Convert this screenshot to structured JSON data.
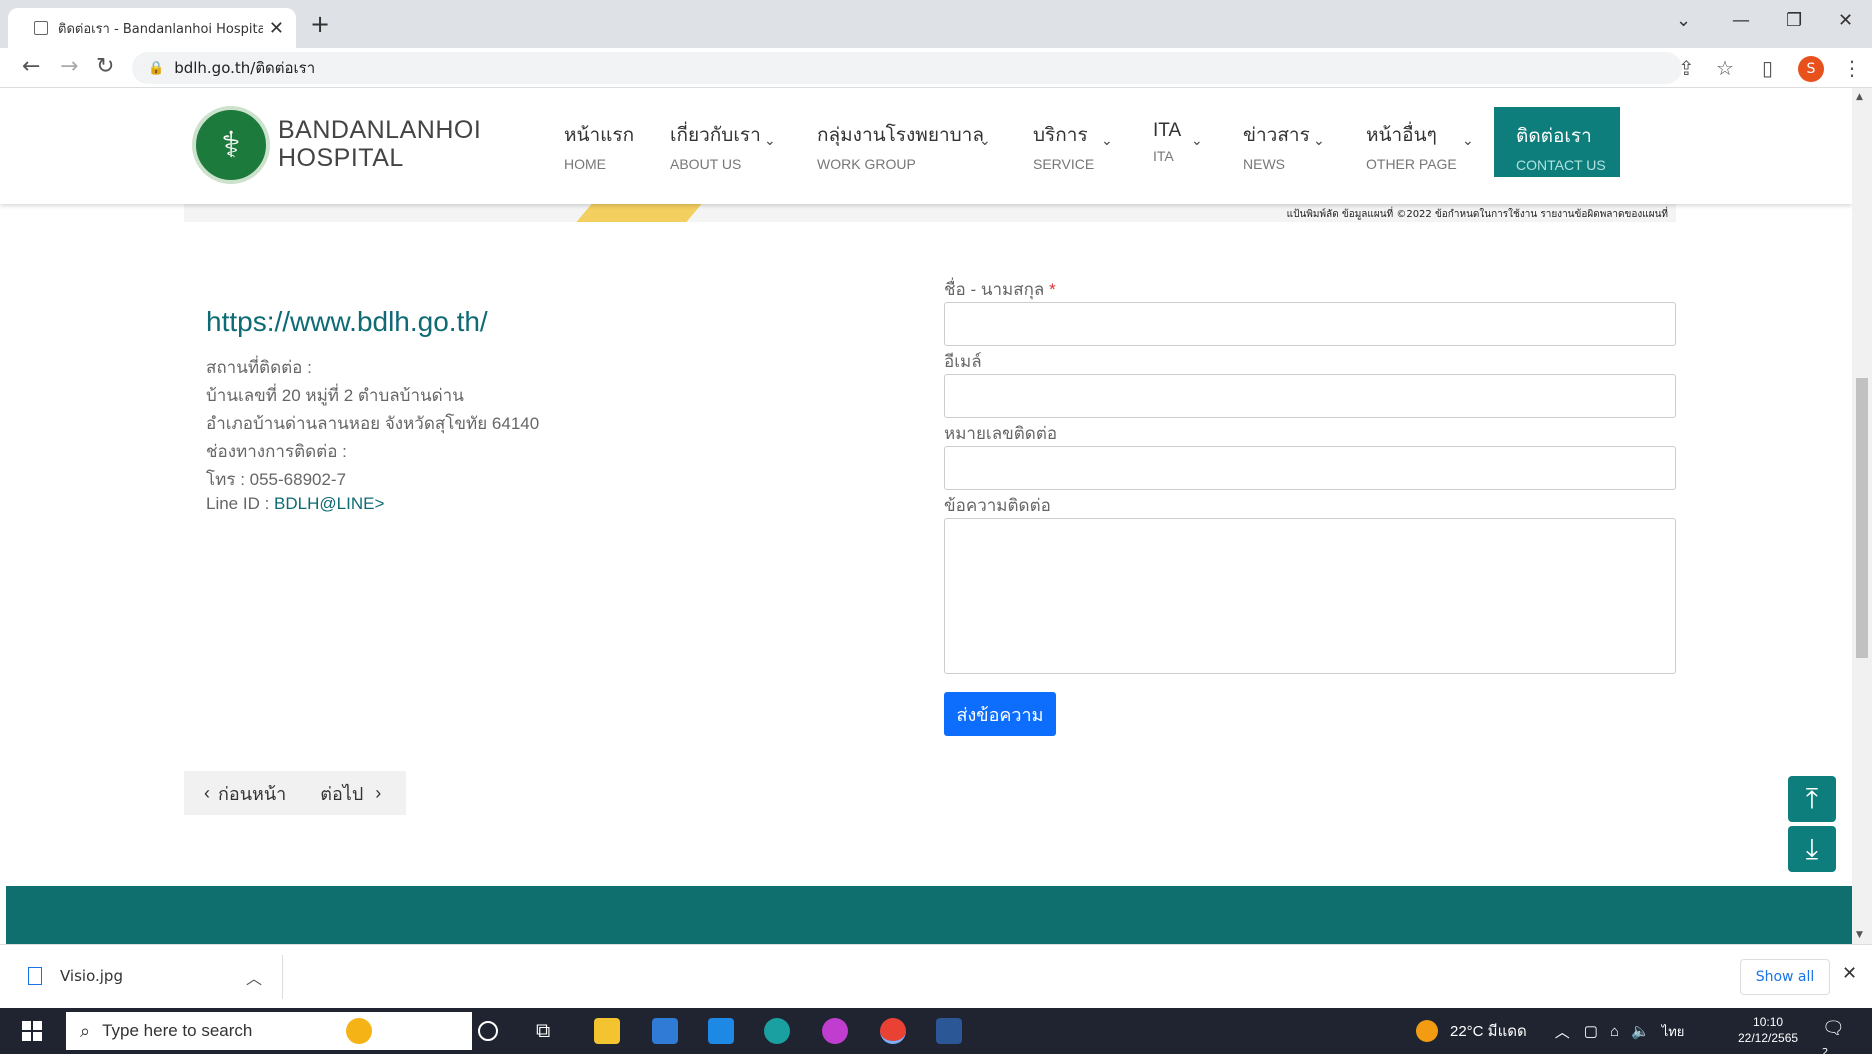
{
  "browser": {
    "tab_title": "ติดต่อเรา - Bandanlanhoi Hospital",
    "tab_close": "✕",
    "new_tab": "+",
    "url": "bdlh.go.th/ติดต่อเรา",
    "profile_initial": "S"
  },
  "site": {
    "brand_line1": "BANDANLANHOI",
    "brand_line2": "HOSPITAL",
    "menu": [
      {
        "th": "หน้าแรก",
        "en": "HOME"
      },
      {
        "th": "เกี่ยวกับเรา",
        "en": "ABOUT US"
      },
      {
        "th": "กลุ่มงานโรงพยาบาล",
        "en": "WORK GROUP"
      },
      {
        "th": "บริการ",
        "en": "SERVICE"
      },
      {
        "th": "ITA",
        "en": "ITA"
      },
      {
        "th": "ข่าวสาร",
        "en": "NEWS"
      },
      {
        "th": "หน้าอื่นๆ",
        "en": "OTHER PAGE"
      },
      {
        "th": "ติดต่อเรา",
        "en": "CONTACT US"
      }
    ],
    "map_attribution": "แป้นพิมพ์ลัด   ข้อมูลแผนที่ ©2022   ข้อกำหนดในการใช้งาน   รายงานข้อผิดพลาดของแผนที่"
  },
  "contact_info": {
    "url": "https://www.bdlh.go.th/",
    "location_label": "สถานที่ติดต่อ :",
    "address1": "บ้านเลขที่ 20 หมู่ที่ 2 ตำบลบ้านด่าน",
    "address2": "อำเภอบ้านด่านลานหอย จังหวัดสุโขทัย 64140",
    "channel_label": "ช่องทางการติดต่อ :",
    "phone": "โทร : 055-68902-7",
    "line_prefix": "Line ID : ",
    "line_id": "BDLH@LINE>"
  },
  "form": {
    "name_label": "ชื่อ - นามสกุล",
    "required_mark": "*",
    "email_label": "อีเมล์",
    "phone_label": "หมายเลขติดต่อ",
    "message_label": "ข้อความติดต่อ",
    "submit_label": "ส่งข้อความ"
  },
  "pager": {
    "prev": "ก่อนหน้า",
    "next": "ต่อไป"
  },
  "downloads": {
    "file_name": "Visio.jpg",
    "show_all": "Show all"
  },
  "taskbar": {
    "search_placeholder": "Type here to search",
    "weather": "22°C มีแดด",
    "language": "ไทย",
    "time": "10:10",
    "date": "22/12/2565",
    "notification_count": "2"
  },
  "colors": {
    "brand_teal": "#0e7e7c",
    "submit_blue": "#0d6efd",
    "link_teal": "#0e6b74"
  }
}
